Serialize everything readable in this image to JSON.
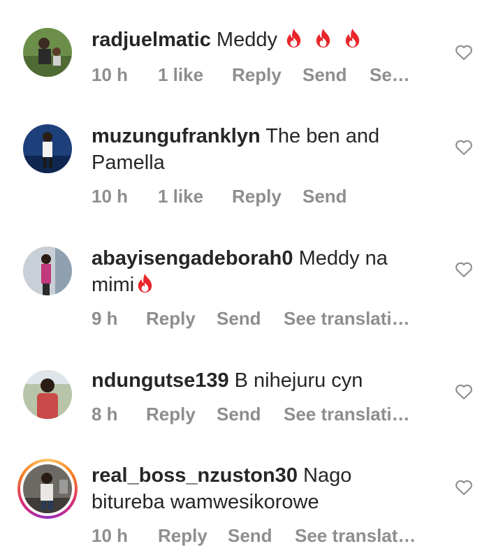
{
  "comments": [
    {
      "username": "radjuelmatic",
      "text": "Meddy",
      "emoji": [
        "fire",
        "fire",
        "fire"
      ],
      "time": "10 h",
      "likes": "1 like",
      "reply": "Reply",
      "send": "Send",
      "translate": "Se…"
    },
    {
      "username": "muzungufranklyn",
      "text": "The ben and Pamella",
      "time": "10 h",
      "likes": "1 like",
      "reply": "Reply",
      "send": "Send"
    },
    {
      "username": "abayisengadeborah0",
      "text": "Meddy na mimi",
      "emoji": [
        "fire"
      ],
      "time": "9 h",
      "reply": "Reply",
      "send": "Send",
      "translate": "See translati…"
    },
    {
      "username": "ndungutse139",
      "text": "B nihejuru cyn",
      "time": "8 h",
      "reply": "Reply",
      "send": "Send",
      "translate": "See translati…"
    },
    {
      "username": "real_boss_nzuston30",
      "text": "Nago bitureba wamwesikorowe",
      "time": "10 h",
      "reply": "Reply",
      "send": "Send",
      "translate": "See translat…",
      "story_ring": true
    }
  ],
  "icons": {
    "like": "heart-outline-icon",
    "emoji": "fire-emoji-icon"
  },
  "colors": {
    "meta_text": "#8e8e8e",
    "fire": "#e8262a",
    "story_ring": [
      "#fdc468",
      "#fa7e1e",
      "#d62976",
      "#962fbf"
    ]
  }
}
